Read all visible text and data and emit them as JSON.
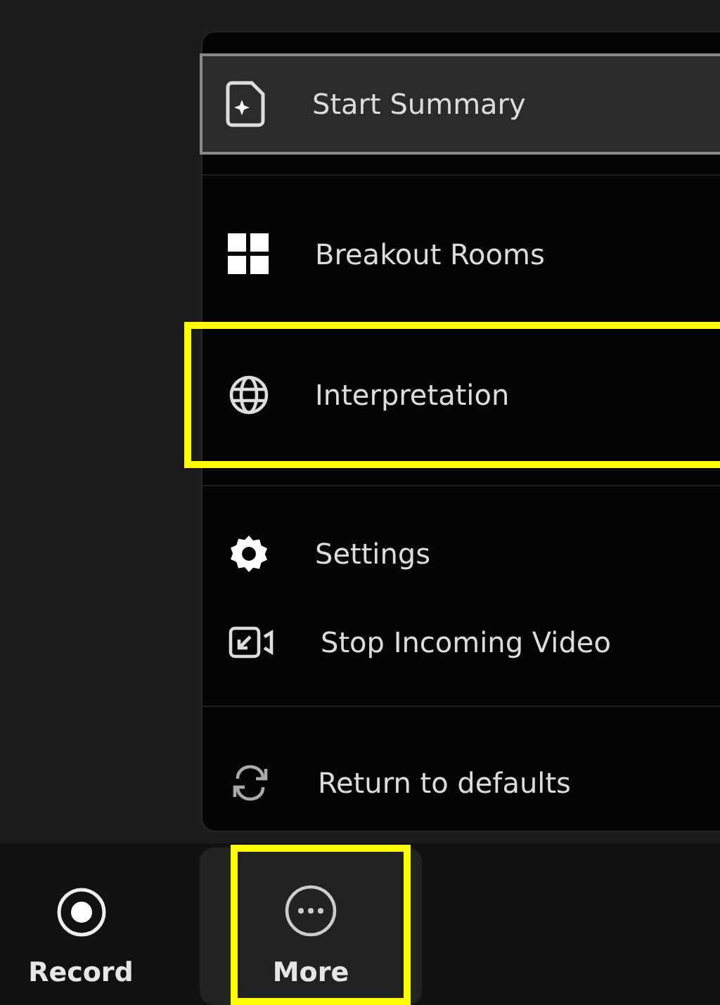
{
  "menu": {
    "groups": [
      {
        "items": [
          {
            "label": "Start Summary",
            "focused": true,
            "highlighted": false
          }
        ]
      },
      {
        "items": [
          {
            "label": "Breakout Rooms",
            "focused": false,
            "highlighted": false
          },
          {
            "label": "Interpretation",
            "focused": false,
            "highlighted": true
          }
        ]
      },
      {
        "items": [
          {
            "label": "Settings",
            "focused": false,
            "highlighted": false
          },
          {
            "label": "Stop Incoming Video",
            "focused": false,
            "highlighted": false
          }
        ]
      },
      {
        "items": [
          {
            "label": "Return to defaults",
            "focused": false,
            "highlighted": false
          }
        ]
      }
    ]
  },
  "toolbar": {
    "buttons": [
      {
        "label": "Record",
        "active": false,
        "highlighted": false
      },
      {
        "label": "More",
        "active": true,
        "highlighted": true
      }
    ]
  }
}
